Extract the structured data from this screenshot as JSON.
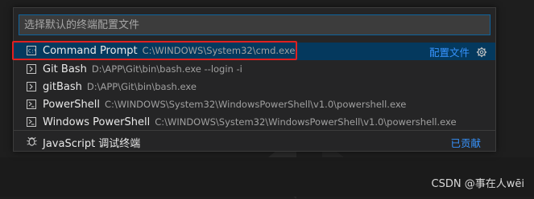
{
  "quick_pick": {
    "placeholder": "选择默认的终端配置文件",
    "items": [
      {
        "label": "Command Prompt",
        "description": "C:\\WINDOWS\\System32\\cmd.exe",
        "icon": "terminal-cmd-icon",
        "selected": true
      },
      {
        "label": "Git Bash",
        "description": "D:\\APP\\Git\\bin\\bash.exe --login -i",
        "icon": "terminal-icon"
      },
      {
        "label": "gitBash",
        "description": "D:\\APP\\Git\\bin\\bash.exe",
        "icon": "terminal-icon"
      },
      {
        "label": "PowerShell",
        "description": "C:\\WINDOWS\\System32\\WindowsPowerShell\\v1.0\\powershell.exe",
        "icon": "terminal-powershell-icon"
      },
      {
        "label": "Windows PowerShell",
        "description": "C:\\WINDOWS\\System32\\WindowsPowerShell\\v1.0\\powershell.exe",
        "icon": "terminal-powershell-icon"
      }
    ],
    "selected_action_label": "配置文件",
    "contributed": {
      "label": "JavaScript 调试终端",
      "badge": "已贡献",
      "icon": "bug-icon"
    }
  },
  "watermark": "CSDN @事在人wēi",
  "colors": {
    "accent": "#3794ff",
    "selection": "#04395e",
    "highlight_box": "#e02020",
    "focus_border": "#0e639c"
  }
}
